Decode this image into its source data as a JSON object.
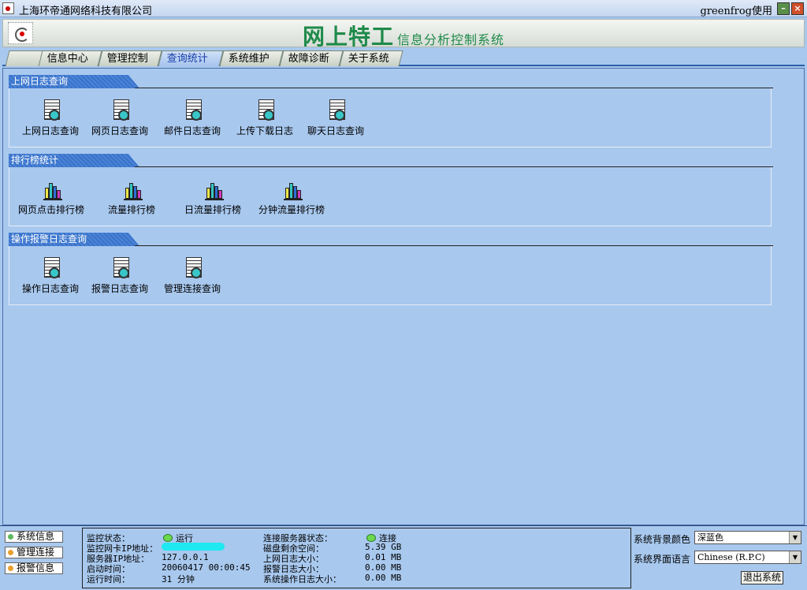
{
  "window": {
    "title": "上海环帝通网络科技有限公司",
    "user": "greenfrog使用",
    "min_glyph": "–",
    "close_glyph": "×"
  },
  "header": {
    "brand": "网上特工",
    "subtitle": "信息分析控制系统"
  },
  "tabs": [
    {
      "label": "信息中心"
    },
    {
      "label": "管理控制"
    },
    {
      "label": "查询统计"
    },
    {
      "label": "系统维护"
    },
    {
      "label": "故障诊断"
    },
    {
      "label": "关于系统"
    }
  ],
  "active_tab": "查询统计",
  "sections": [
    {
      "title": "上网日志查询",
      "icon": "log-document-icon",
      "items": [
        "上网日志查询",
        "网页日志查询",
        "邮件日志查询",
        "上传下载日志",
        "聊天日志查询"
      ]
    },
    {
      "title": "排行榜统计",
      "icon": "bar-chart-icon",
      "items": [
        "网页点击排行榜",
        "流量排行榜",
        "日流量排行榜",
        "分钟流量排行榜"
      ]
    },
    {
      "title": "操作报警日志查询",
      "icon": "log-document-icon",
      "items": [
        "操作日志查询",
        "报警日志查询",
        "管理连接查询"
      ]
    }
  ],
  "side_buttons": [
    "系统信息",
    "管理连接",
    "报警信息"
  ],
  "status": {
    "monitor_label": "监控状态：",
    "monitor_value": "运行",
    "nic_ip_label": "监控网卡IP地址：",
    "server_ip_label": "服务器IP地址：",
    "server_ip_value": "127.0.0.1",
    "start_label": "启动时间：",
    "start_value": "20060417 00:00:45",
    "run_label": "运行时间：",
    "run_value": "31 分钟",
    "conn_label": "连接服务器状态：",
    "conn_value": "连接",
    "disk_label": "磁盘剩余空间：",
    "disk_value": "5.39 GB",
    "web_log_label": "上网日志大小：",
    "web_log_value": "0.01 MB",
    "alarm_log_label": "报警日志大小：",
    "alarm_log_value": "0.00 MB",
    "op_log_label": "系统操作日志大小：",
    "op_log_value": "0.00 MB"
  },
  "settings": {
    "bg_label": "系统背景颜色",
    "bg_value": "深蓝色",
    "lang_label": "系统界面语言",
    "lang_value": "Chinese (R.P.C)",
    "exit_label": "退出系统",
    "arrow_glyph": "▼"
  },
  "colors": {
    "brand_green": "#1f8a4a",
    "background": "#a8c8ee",
    "section_header": "#3a72c8",
    "status_dot": "#6cd84c",
    "masked_ip": "#1ee8f0"
  }
}
